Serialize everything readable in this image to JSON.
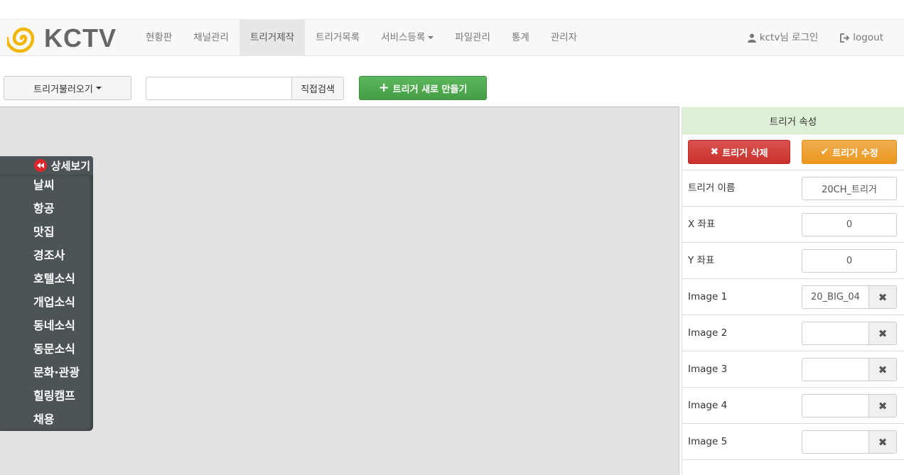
{
  "brand": {
    "name": "KCTV",
    "accent": "#f2b705"
  },
  "nav": {
    "items": [
      {
        "label": "현황판"
      },
      {
        "label": "채널관리"
      },
      {
        "label": "트리거제작",
        "active": true
      },
      {
        "label": "트리거목록"
      },
      {
        "label": "서비스등록",
        "dropdown": true
      },
      {
        "label": "파일관리"
      },
      {
        "label": "통계"
      },
      {
        "label": "관리자"
      }
    ],
    "user_label": "kctv님 로그인",
    "logout_label": "logout"
  },
  "toolbar": {
    "load_label": "트리거불러오기",
    "search_value": "",
    "search_button": "직접검색",
    "new_label": "트리거 새로 만들기"
  },
  "side_menu": {
    "detail_label": "상세보기",
    "items": [
      "날씨",
      "항공",
      "맛집",
      "경조사",
      "호텔소식",
      "개업소식",
      "동네소식",
      "동문소식",
      "문화·관광",
      "힐링캠프",
      "채용"
    ]
  },
  "panel": {
    "title": "트리거 속성",
    "delete_label": "트리거 삭제",
    "edit_label": "트리거 수정",
    "props": [
      {
        "label": "트리거 이름",
        "value": "20CH_트리거",
        "clearable": false
      },
      {
        "label": "X 좌표",
        "value": "0",
        "clearable": false
      },
      {
        "label": "Y 좌표",
        "value": "0",
        "clearable": false
      },
      {
        "label": "Image 1",
        "value": "20_BIG_04",
        "clearable": true
      },
      {
        "label": "Image 2",
        "value": "",
        "clearable": true
      },
      {
        "label": "Image 3",
        "value": "",
        "clearable": true
      },
      {
        "label": "Image 4",
        "value": "",
        "clearable": true
      },
      {
        "label": "Image 5",
        "value": "",
        "clearable": true
      }
    ]
  },
  "colors": {
    "success": "#5cb85c",
    "danger": "#d9534f",
    "warning": "#f0ad4e",
    "menu_bg": "#4d5458",
    "panel_head_bg": "#dff0d8"
  }
}
